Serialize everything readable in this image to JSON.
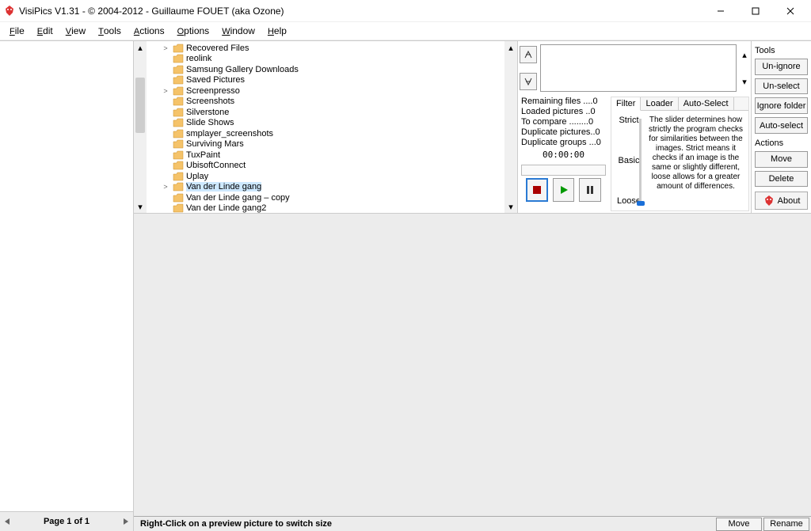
{
  "title": "VisiPics V1.31 - © 2004-2012 - Guillaume FOUET (aka Ozone)",
  "menu": [
    "File",
    "Edit",
    "View",
    "Tools",
    "Actions",
    "Options",
    "Window",
    "Help"
  ],
  "tree": [
    {
      "label": "Recovered Files",
      "expander": ">",
      "indent": 1
    },
    {
      "label": "reolink",
      "expander": "",
      "indent": 1
    },
    {
      "label": "Samsung Gallery Downloads",
      "expander": "",
      "indent": 1
    },
    {
      "label": "Saved Pictures",
      "expander": "",
      "indent": 1
    },
    {
      "label": "Screenpresso",
      "expander": ">",
      "indent": 1
    },
    {
      "label": "Screenshots",
      "expander": "",
      "indent": 1
    },
    {
      "label": "Silverstone",
      "expander": "",
      "indent": 1
    },
    {
      "label": "Slide Shows",
      "expander": "",
      "indent": 1
    },
    {
      "label": "smplayer_screenshots",
      "expander": "",
      "indent": 1
    },
    {
      "label": "Surviving Mars",
      "expander": "",
      "indent": 1
    },
    {
      "label": "TuxPaint",
      "expander": "",
      "indent": 1
    },
    {
      "label": "UbisoftConnect",
      "expander": "",
      "indent": 1
    },
    {
      "label": "Uplay",
      "expander": "",
      "indent": 1
    },
    {
      "label": "Van der Linde gang",
      "expander": ">",
      "indent": 1,
      "selected": true
    },
    {
      "label": "Van der Linde gang – copy",
      "expander": "",
      "indent": 1
    },
    {
      "label": "Van der Linde gang2",
      "expander": "",
      "indent": 1
    }
  ],
  "stats": {
    "remaining": "Remaining files ....0",
    "loaded": "Loaded pictures ..0",
    "compare": "To compare ........0",
    "dup_pics": "Duplicate pictures..0",
    "dup_groups": "Duplicate groups ...0",
    "timer": "00:00:00"
  },
  "filter": {
    "tabs": [
      "Filter",
      "Loader",
      "Auto-Select"
    ],
    "levels": [
      "Strict",
      "Basic",
      "Loose"
    ],
    "desc": "The slider determines how strictly the program checks for similarities between the images. Strict means it checks if an image is the same or slightly different, loose allows for a greater amount of differences."
  },
  "tools": {
    "heading": "Tools",
    "buttons": [
      "Un-ignore",
      "Un-select",
      "Ignore folder",
      "Auto-select"
    ]
  },
  "actions": {
    "heading": "Actions",
    "buttons": [
      "Move",
      "Delete"
    ],
    "about": "About"
  },
  "pager": "Page 1 of 1",
  "status": {
    "hint": "Right-Click on a preview picture to switch size",
    "buttons": [
      "Move",
      "Rename"
    ]
  }
}
